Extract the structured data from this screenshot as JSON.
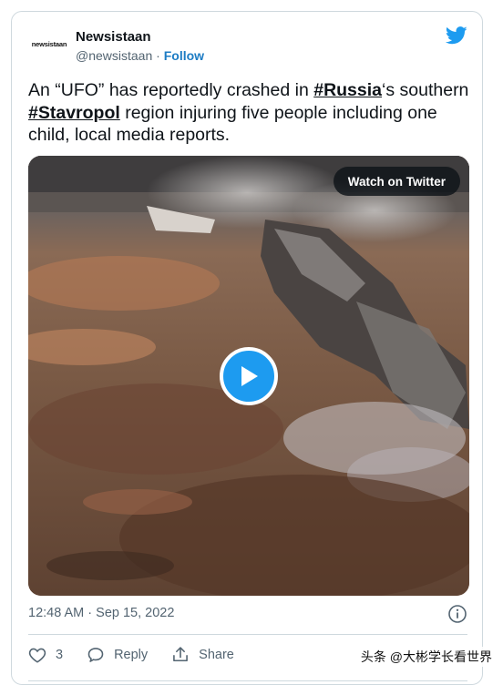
{
  "tweet": {
    "author": {
      "avatar_text": "newsistaan",
      "name": "Newsistaan",
      "handle": "@newsistaan",
      "separator": "·",
      "follow_label": "Follow"
    },
    "text_parts": {
      "p1": "An “UFO” has reportedly crashed in ",
      "hashtag1": "#Russia",
      "p2": "‘s southern ",
      "hashtag2": "#Stavropol",
      "p3": " region injuring five people including one child, local media reports."
    },
    "media": {
      "watch_label": "Watch on Twitter"
    },
    "timestamp": "12:48 AM · Sep 15, 2022",
    "actions": {
      "like_count": "3",
      "reply_label": "Reply",
      "share_label": "Share"
    }
  },
  "overlay": {
    "watermark": "头条 @大彬学长看世界"
  },
  "colors": {
    "accent": "#1d9bf0",
    "follow_link": "#1d7cc4",
    "muted_text": "#536471",
    "border": "#cfd9de"
  }
}
